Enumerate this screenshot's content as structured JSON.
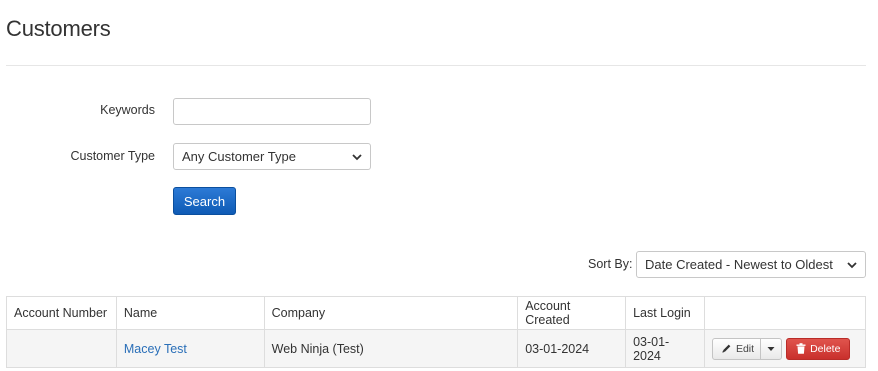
{
  "page": {
    "title": "Customers"
  },
  "filters": {
    "keywords_label": "Keywords",
    "keywords_value": "",
    "customer_type_label": "Customer Type",
    "customer_type_selected": "Any Customer Type",
    "search_label": "Search"
  },
  "sort": {
    "label": "Sort By:",
    "selected": "Date Created - Newest to Oldest"
  },
  "table": {
    "headers": [
      "Account Number",
      "Name",
      "Company",
      "Account Created",
      "Last Login",
      ""
    ],
    "rows": [
      {
        "account_number": "",
        "name": "Macey Test",
        "company": "Web Ninja (Test)",
        "account_created": "03-01-2024",
        "last_login": "03-01-2024",
        "edit_label": "Edit",
        "delete_label": "Delete"
      }
    ]
  },
  "colors": {
    "primary": "#1467c7",
    "danger": "#d9534f",
    "link": "#2a6fb8"
  }
}
